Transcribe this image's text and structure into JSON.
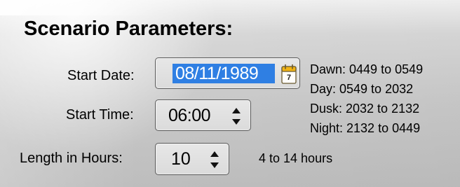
{
  "panel": {
    "title": "Scenario Parameters:",
    "start_date": {
      "label": "Start Date:",
      "value": "08/11/1989",
      "calendar_day": "7"
    },
    "start_time": {
      "label": "Start Time:",
      "value": "06:00"
    },
    "length": {
      "label": "Length in Hours:",
      "value": "10",
      "hint": "4 to 14 hours"
    },
    "time_ranges": [
      {
        "text": "Dawn: 0449 to 0549"
      },
      {
        "text": "Day: 0549 to 2032"
      },
      {
        "text": "Dusk: 2032 to 2132"
      },
      {
        "text": "Night: 2132 to 0449"
      }
    ]
  },
  "icons": {
    "calendar": "calendar-icon",
    "spinner": "spinner-icon"
  },
  "colors": {
    "selection": "#2f7fe3",
    "calendar_accent": "#f1b313"
  }
}
